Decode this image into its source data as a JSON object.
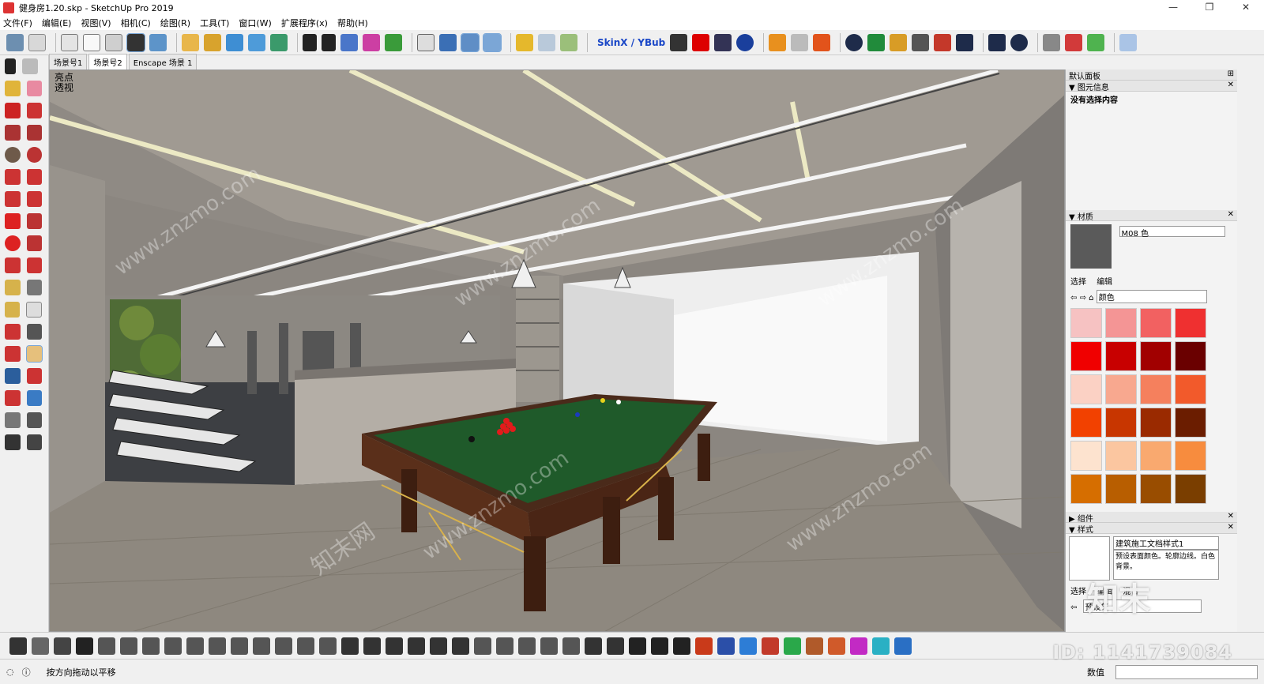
{
  "window": {
    "title": "健身房1.20.skp - SketchUp Pro 2019",
    "controls": [
      "—",
      "❐",
      "✕"
    ]
  },
  "menu": [
    "文件(F)",
    "编辑(E)",
    "视图(V)",
    "相机(C)",
    "绘图(R)",
    "工具(T)",
    "窗口(W)",
    "扩展程序(x)",
    "帮助(H)"
  ],
  "toolbar": {
    "skinx_label_1": "SkinX / ",
    "skinx_label_2": "YBub"
  },
  "scene_tabs": [
    "场景号1",
    "场景号2",
    "Enscape 场景 1"
  ],
  "viewport": {
    "style_label_1": "亮点",
    "style_label_2": "透视",
    "watermark": "www.znzmo.com",
    "watermark_cn": "知末网"
  },
  "right_panel": {
    "tray_title": "默认面板",
    "entity_info": {
      "header": "图元信息",
      "status": "没有选择内容"
    },
    "materials": {
      "header": "材质",
      "material_name": "M08 色",
      "tabs": [
        "选择",
        "编辑"
      ],
      "library": "颜色",
      "swatches": [
        "#f6c2c2",
        "#f49595",
        "#f26161",
        "#ef3030",
        "#f00000",
        "#c80000",
        "#a10000",
        "#6a0000",
        "#fbd1c4",
        "#f8a88f",
        "#f5805d",
        "#f25a2b",
        "#f24100",
        "#c83600",
        "#9a2a00",
        "#6b1d00",
        "#fde3cf",
        "#fbc6a0",
        "#f9a96f",
        "#f78c3e",
        "#d66e00",
        "#b85e00",
        "#994d00",
        "#7a3e00"
      ]
    },
    "components": {
      "header": "组件"
    },
    "styles": {
      "header": "样式",
      "style_name": "建筑施工文档样式1",
      "style_desc": "预设表面颜色。轮廓边线。白色背景。",
      "tabs": [
        "选择",
        "编辑",
        "混合"
      ],
      "collection": "预设集"
    }
  },
  "status": {
    "hint": "按方向拖动以平移",
    "vcb_label": "数值",
    "vcb_value": ""
  },
  "overlay": {
    "brand": "知末",
    "id_text": "ID: 1141739084"
  }
}
